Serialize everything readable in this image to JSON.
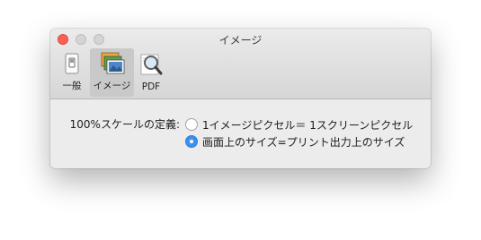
{
  "window": {
    "title": "イメージ"
  },
  "toolbar": {
    "items": [
      {
        "label": "一般",
        "icon": "switch-icon",
        "selected": false
      },
      {
        "label": "イメージ",
        "icon": "images-icon",
        "selected": true
      },
      {
        "label": "PDF",
        "icon": "magnifier-icon",
        "selected": false
      }
    ]
  },
  "settings": {
    "scale_label": "100%スケールの定義:",
    "options": [
      {
        "label": "1イメージピクセル＝ 1スクリーンピクセル",
        "selected": false
      },
      {
        "label": "画面上のサイズ=プリント出力上のサイズ",
        "selected": true
      }
    ]
  },
  "colors": {
    "accent": "#3e8ff0",
    "close_button": "#fc5f57"
  }
}
